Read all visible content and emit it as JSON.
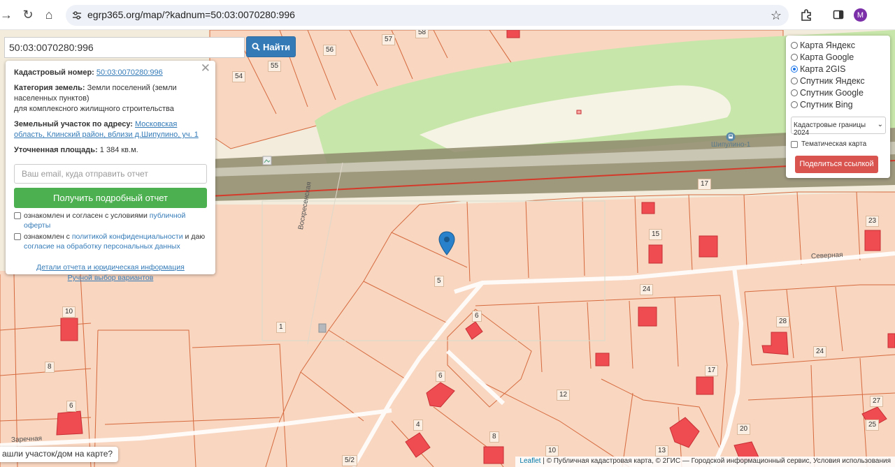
{
  "browser": {
    "url": "egrp365.org/map/?kadnum=50:03:0070280:996",
    "profile_initial": "M"
  },
  "search": {
    "value": "50:03:0070280:996",
    "button_label": "Найти"
  },
  "info": {
    "cadastral_label": "Кадастровый номер:",
    "cadastral_value": "50:03:0070280:996",
    "category_label": "Категория земель:",
    "category_value": "Земли поселений (земли населенных пунктов)",
    "category_use": "для комплексного жилищного строительства",
    "address_label": "Земельный участок по адресу:",
    "address_value": "Московская область, Клинский район, вблизи д.Шипулино, уч. 1",
    "area_label": "Уточненная площадь:",
    "area_value": "1 384 кв.м.",
    "email_placeholder": "Ваш email, куда отправить отчет",
    "report_button": "Получить подробный отчет",
    "consent1_text": "ознакомлен и согласен с условиями",
    "consent1_link": "публичной оферты",
    "consent2_text": "ознакомлен с",
    "consent2_link": "политикой конфиденциальности",
    "consent2_mid": "и даю",
    "consent2_link2": "согласие на обработку персональных данных",
    "details_link": "Детали отчета и юридическая информация",
    "manual_link": "Ручной выбор вариантов"
  },
  "layers": {
    "options": [
      "Карта Яндекс",
      "Карта Google",
      "Карта 2GIS",
      "Спутник Яндекс",
      "Спутник Google",
      "Спутник Bing"
    ],
    "selected": "Карта 2GIS",
    "overlay_select": "Кадастровые границы 2024",
    "thematic_label": "Тематическая карта",
    "share_button": "Поделиться ссылкой"
  },
  "map": {
    "bus_stop": "Шипулино-1",
    "streets": [
      "Воскресенская",
      "Северная",
      "Заречная"
    ],
    "labels": [
      "58",
      "57",
      "56",
      "55",
      "54",
      "17",
      "15",
      "23",
      "24",
      "5",
      "6",
      "1",
      "10",
      "8",
      "6",
      "28",
      "24",
      "17",
      "12",
      "6",
      "4",
      "8",
      "10",
      "5/2",
      "13",
      "20",
      "27",
      "25"
    ]
  },
  "bottom_note": "ашли участок/дом на карте?",
  "attribution": {
    "leaflet": "Leaflet",
    "text": "| © Публичная кадастровая карта, © 2ГИС — Городской информационный сервис, Условия использования"
  },
  "colors": {
    "plot_fill": "#f8d6c0",
    "plot_border": "#d66a3e",
    "building": "#ef4c52",
    "road_band": "#8e8a6c",
    "green_zone": "#c7e6a9",
    "accent_blue": "#337ab7",
    "report_green": "#4caf50",
    "share_red": "#d9534f"
  }
}
